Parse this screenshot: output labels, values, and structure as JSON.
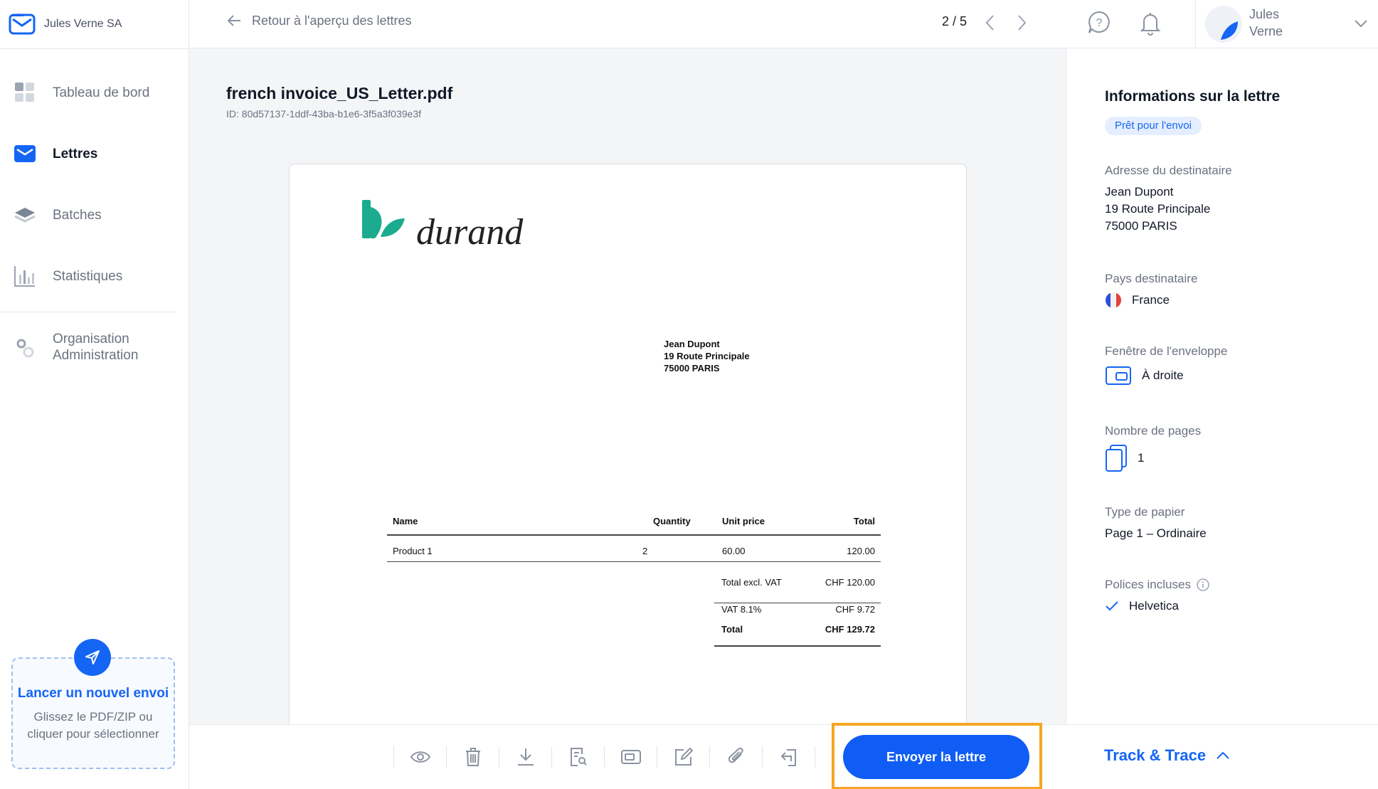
{
  "brand": {
    "name": "Jules Verne SA"
  },
  "sidebar": {
    "items": [
      {
        "label": "Tableau de bord",
        "icon": "dashboard-icon"
      },
      {
        "label": "Lettres",
        "icon": "envelope-icon"
      },
      {
        "label": "Batches",
        "icon": "layers-icon"
      },
      {
        "label": "Statistiques",
        "icon": "bar-chart-icon"
      },
      {
        "label": "Organisation\nAdministration",
        "icon": "gear-icon"
      }
    ],
    "upload": {
      "title": "Lancer un nouvel envoi",
      "subtitle": "Glissez le PDF/ZIP ou cliquer pour sélectionner"
    }
  },
  "topbar": {
    "back_label": "Retour à l'aperçu des lettres",
    "pager": "2 / 5",
    "user": {
      "first": "Jules",
      "last": "Verne"
    }
  },
  "document": {
    "title": "french invoice_US_Letter.pdf",
    "id": "ID: 80d57137-1ddf-43ba-b1e6-3f5a3f039e3f",
    "logo_text": "durand",
    "address": [
      "Jean Dupont",
      "19 Route Principale",
      "75000 PARIS"
    ],
    "invoice": {
      "headers": {
        "name": "Name",
        "quantity": "Quantity",
        "unit_price": "Unit price",
        "total": "Total"
      },
      "rows": [
        {
          "name": "Product 1",
          "quantity": "2",
          "unit_price": "60.00",
          "total": "120.00"
        }
      ],
      "total_excl_label": "Total excl. VAT",
      "total_excl_value": "CHF 120.00",
      "vat_label": "VAT 8.1%",
      "vat_value": "CHF 9.72",
      "total_label": "Total",
      "total_value": "CHF 129.72"
    }
  },
  "toolbar": {
    "send_label": "Envoyer la lettre",
    "track_label": "Track & Trace",
    "tools": [
      "eye-icon",
      "trash-icon",
      "download-icon",
      "document-search-icon",
      "envelope-window-icon",
      "edit-icon",
      "paperclip-icon",
      "return-icon"
    ]
  },
  "info": {
    "title": "Informations sur la lettre",
    "status": "Prêt pour l'envoi",
    "recipient_label": "Adresse du destinataire",
    "recipient": [
      "Jean Dupont",
      "19 Route Principale",
      "75000 PARIS"
    ],
    "country_label": "Pays destinataire",
    "country": "France",
    "window_label": "Fenêtre de l'enveloppe",
    "window": "À droite",
    "pages_label": "Nombre de pages",
    "pages": "1",
    "paper_label": "Type de papier",
    "paper": "Page 1 – Ordinaire",
    "fonts_label": "Polices incluses",
    "fonts": "Helvetica"
  },
  "colors": {
    "accent": "#1565f5",
    "highlight": "#f5a623",
    "logo": "#1bab8f"
  }
}
